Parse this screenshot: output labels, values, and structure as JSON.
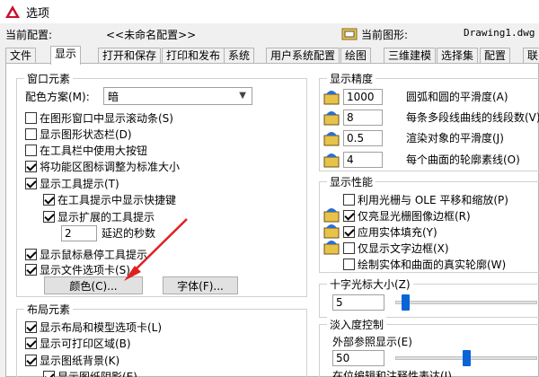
{
  "window": {
    "title": "选项"
  },
  "config": {
    "current_config_label": "当前配置:",
    "current_config_value": "<<未命名配置>>",
    "current_drawing_label": "当前图形:",
    "current_drawing_value": "Drawing1.dwg"
  },
  "tabs": [
    "文件",
    "显示",
    "打开和保存",
    "打印和发布",
    "系统",
    "用户系统配置",
    "绘图",
    "三维建模",
    "选择集",
    "配置",
    "联"
  ],
  "active_tab": "显示",
  "window_elements": {
    "title": "窗口元素",
    "color_scheme_label": "配色方案(M):",
    "color_scheme_value": "暗",
    "checkboxes": [
      {
        "label": "在图形窗口中显示滚动条(S)",
        "checked": false
      },
      {
        "label": "显示图形状态栏(D)",
        "checked": false
      },
      {
        "label": "在工具栏中使用大按钮",
        "checked": false
      },
      {
        "label": "将功能区图标调整为标准大小",
        "checked": true
      },
      {
        "label": "显示工具提示(T)",
        "checked": true
      },
      {
        "label": "在工具提示中显示快捷键",
        "checked": true
      },
      {
        "label": "显示扩展的工具提示",
        "checked": true
      },
      {
        "label": "显示鼠标悬停工具提示",
        "checked": true
      },
      {
        "label": "显示文件选项卡(S)",
        "checked": true
      }
    ],
    "delay_value": "2",
    "delay_label": "延迟的秒数",
    "colors_button": "颜色(C)...",
    "fonts_button": "字体(F)..."
  },
  "layout_elements": {
    "title": "布局元素",
    "checkboxes": [
      {
        "label": "显示布局和模型选项卡(L)",
        "checked": true
      },
      {
        "label": "显示可打印区域(B)",
        "checked": true
      },
      {
        "label": "显示图纸背景(K)",
        "checked": true
      },
      {
        "label": "显示图纸阴影(E)",
        "checked": true
      }
    ]
  },
  "display_resolution": {
    "title": "显示精度",
    "items": [
      {
        "value": "1000",
        "label": "圆弧和圆的平滑度(A)"
      },
      {
        "value": "8",
        "label": "每条多段线曲线的线段数(V)"
      },
      {
        "value": "0.5",
        "label": "渲染对象的平滑度(J)"
      },
      {
        "value": "4",
        "label": "每个曲面的轮廓素线(O)"
      }
    ]
  },
  "display_performance": {
    "title": "显示性能",
    "items": [
      {
        "label": "利用光栅与 OLE 平移和缩放(P)",
        "checked": false
      },
      {
        "label": "仅亮显光栅图像边框(R)",
        "checked": true
      },
      {
        "label": "应用实体填充(Y)",
        "checked": true
      },
      {
        "label": "仅显示文字边框(X)",
        "checked": false
      },
      {
        "label": "绘制实体和曲面的真实轮廓(W)",
        "checked": false
      }
    ]
  },
  "crosshair": {
    "title": "十字光标大小(Z)",
    "value": "5",
    "fraction": 0.05
  },
  "fade_control": {
    "title": "淡入度控制",
    "xref_label": "外部参照显示(E)",
    "xref_value": "50",
    "xref_fraction": 0.5,
    "inplace_label": "在位编辑和注释性表达(I)"
  },
  "colors": {
    "accent": "#0a64d6",
    "arrow": "#e02020",
    "icon_red": "#c8102e"
  }
}
